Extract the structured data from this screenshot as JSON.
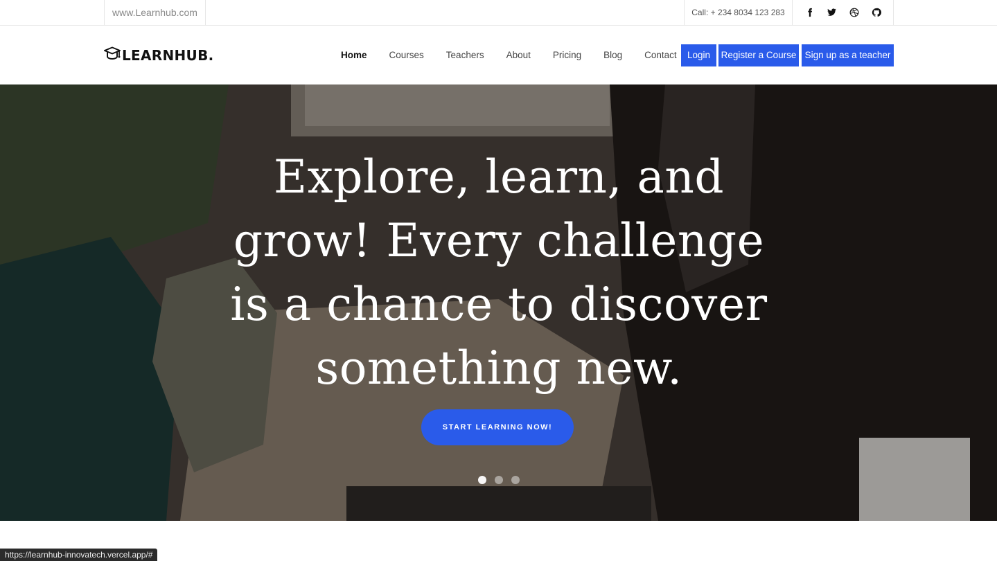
{
  "topbar": {
    "site": "www.Learnhub.com",
    "call": "Call: + 234 8034 123 283",
    "socials": [
      "facebook-icon",
      "twitter-icon",
      "dribbble-icon",
      "github-icon"
    ]
  },
  "nav": {
    "logo_text": "LEARNHUB.",
    "items": [
      {
        "label": "Home",
        "active": true
      },
      {
        "label": "Courses"
      },
      {
        "label": "Teachers"
      },
      {
        "label": "About"
      },
      {
        "label": "Pricing"
      },
      {
        "label": "Blog"
      },
      {
        "label": "Contact"
      }
    ],
    "login": "Login",
    "register": "Register a Course",
    "signup": "Sign up as a teacher"
  },
  "hero": {
    "lines": [
      "Explore, learn, and",
      "grow! Every challenge",
      "is a chance to discover",
      "something new."
    ],
    "cta": "START LEARNING NOW!",
    "slides": 3,
    "active_slide": 1
  },
  "status": {
    "url": "https://learnhub-innovatech.vercel.app/#"
  },
  "colors": {
    "accent": "#2a5bea"
  }
}
